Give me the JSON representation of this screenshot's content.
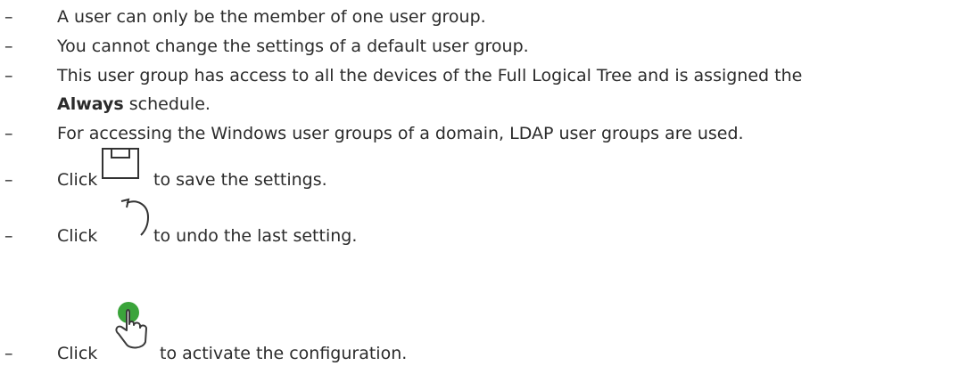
{
  "bullet_symbol": "–",
  "items": [
    {
      "text": "A user can only be the member of one user group."
    },
    {
      "text": "You cannot change the settings of a default user group."
    },
    {
      "line1": "This user group has access to all the devices of the Full Logical Tree and is assigned the",
      "bold": "Always",
      "rest": " schedule."
    },
    {
      "text": "For accessing the Windows user groups of a domain, LDAP user groups are used."
    },
    {
      "click": "Click",
      "after": "to save the settings.",
      "icon": "save-icon"
    },
    {
      "click": "Click",
      "after": "to undo the last setting.",
      "icon": "undo-icon"
    },
    {
      "click": "Click",
      "after": "to activate the configuration.",
      "icon": "activate-configuration-icon",
      "icon_color": "#3aa43a"
    }
  ]
}
